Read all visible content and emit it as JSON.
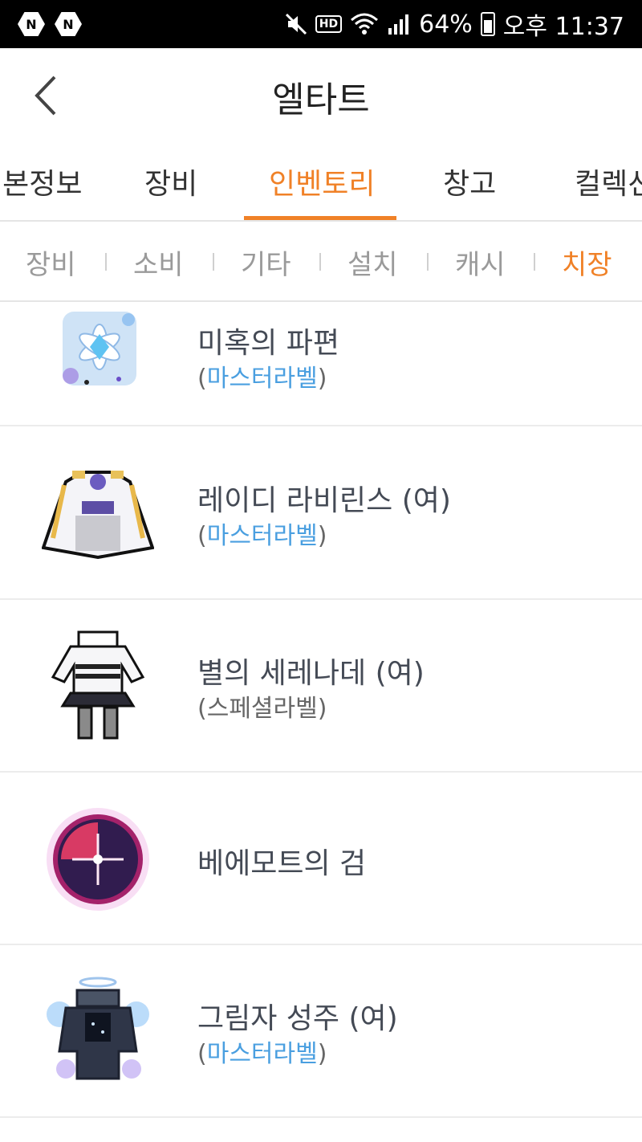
{
  "status_bar": {
    "battery": "64%",
    "time": "오후 11:37",
    "hd": "HD",
    "n_badge_1": "N",
    "n_badge_2": "N"
  },
  "header": {
    "title": "엘타트"
  },
  "main_tabs": [
    {
      "label": "기본정보"
    },
    {
      "label": "장비"
    },
    {
      "label": "인벤토리",
      "active": true
    },
    {
      "label": "창고"
    },
    {
      "label": "컬렉션"
    }
  ],
  "sub_tabs": [
    {
      "label": "장비"
    },
    {
      "label": "소비"
    },
    {
      "label": "기타"
    },
    {
      "label": "설치"
    },
    {
      "label": "캐시"
    },
    {
      "label": "치장",
      "active": true
    }
  ],
  "items": [
    {
      "name": "미혹의 파편",
      "label": "마스터라벨",
      "label_color": "blue",
      "icon": "snowflake-gem-icon"
    },
    {
      "name": "레이디 라비린스 (여)",
      "label": "마스터라벨",
      "label_color": "blue",
      "icon": "white-dress-icon"
    },
    {
      "name": "별의 세레나데 (여)",
      "label": "스페셜라벨",
      "label_color": "gray",
      "icon": "outfit-icon"
    },
    {
      "name": "베에모트의 검",
      "label": "",
      "label_color": "",
      "icon": "dark-orb-icon"
    },
    {
      "name": "그림자 성주 (여)",
      "label": "마스터라벨",
      "label_color": "blue",
      "icon": "shadow-armor-icon"
    }
  ],
  "colors": {
    "accent": "#f08127",
    "label_blue": "#4a9fe0"
  }
}
